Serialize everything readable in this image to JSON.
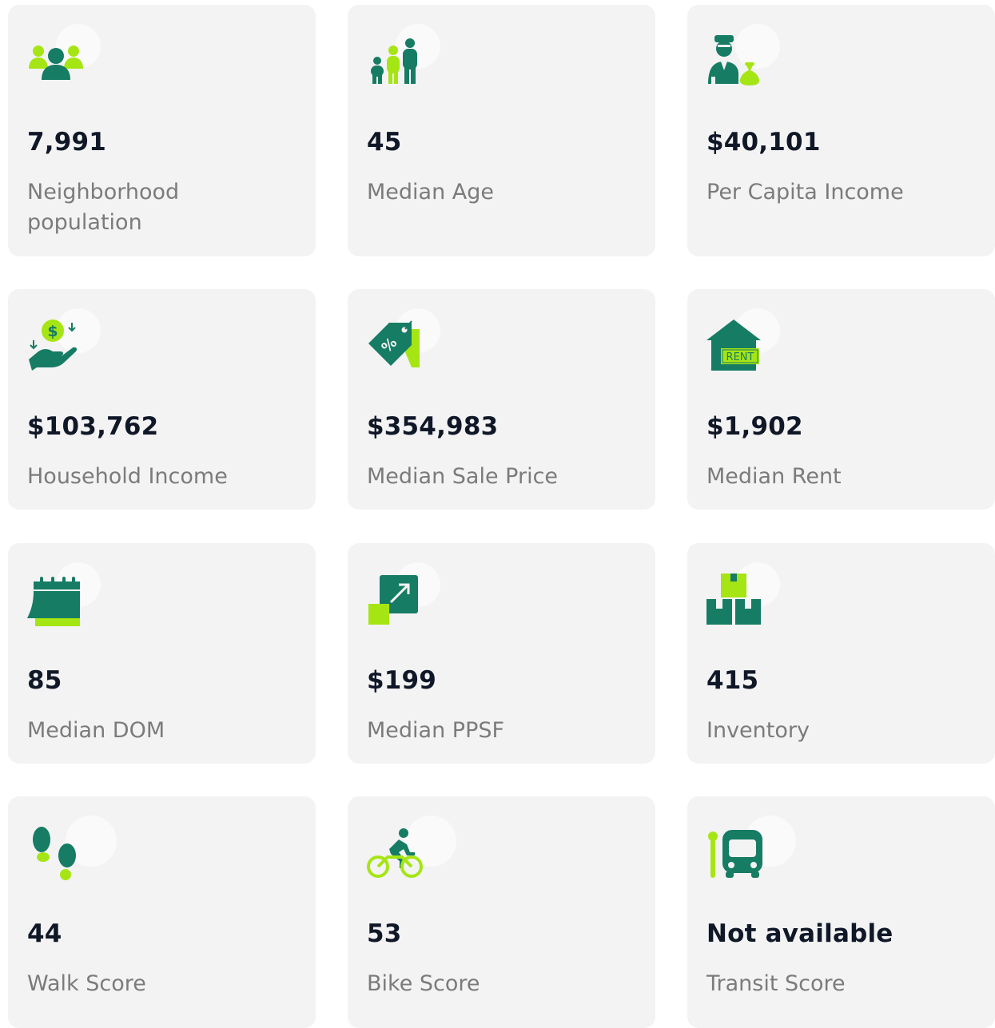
{
  "colors": {
    "dark_green": "#167c64",
    "lime": "#a6e514",
    "card_bg": "#f3f3f3",
    "value_text": "#101828",
    "label_text": "#7b7b7b"
  },
  "stats": [
    {
      "icon": "people-icon",
      "value": "7,991",
      "label": "Neighborhood population"
    },
    {
      "icon": "family-age-icon",
      "value": "45",
      "label": "Median Age"
    },
    {
      "icon": "businessman-money-bag-icon",
      "value": "$40,101",
      "label": "Per Capita Income"
    },
    {
      "icon": "hand-dollar-coin-icon",
      "value": "$103,762",
      "label": "Household Income"
    },
    {
      "icon": "percent-price-tag-icon",
      "value": "$354,983",
      "label": "Median Sale Price"
    },
    {
      "icon": "rent-house-icon",
      "value": "$1,902",
      "label": "Median Rent"
    },
    {
      "icon": "calendar-icon",
      "value": "85",
      "label": "Median DOM"
    },
    {
      "icon": "expand-square-icon",
      "value": "$199",
      "label": "Median PPSF"
    },
    {
      "icon": "boxes-icon",
      "value": "415",
      "label": "Inventory"
    },
    {
      "icon": "footprints-icon",
      "value": "44",
      "label": "Walk Score"
    },
    {
      "icon": "cyclist-icon",
      "value": "53",
      "label": "Bike Score"
    },
    {
      "icon": "bus-stop-icon",
      "value": "Not available",
      "label": "Transit Score"
    }
  ],
  "icon_text": {
    "rent_sign": "RENT",
    "dollar": "$",
    "percent": "%"
  }
}
